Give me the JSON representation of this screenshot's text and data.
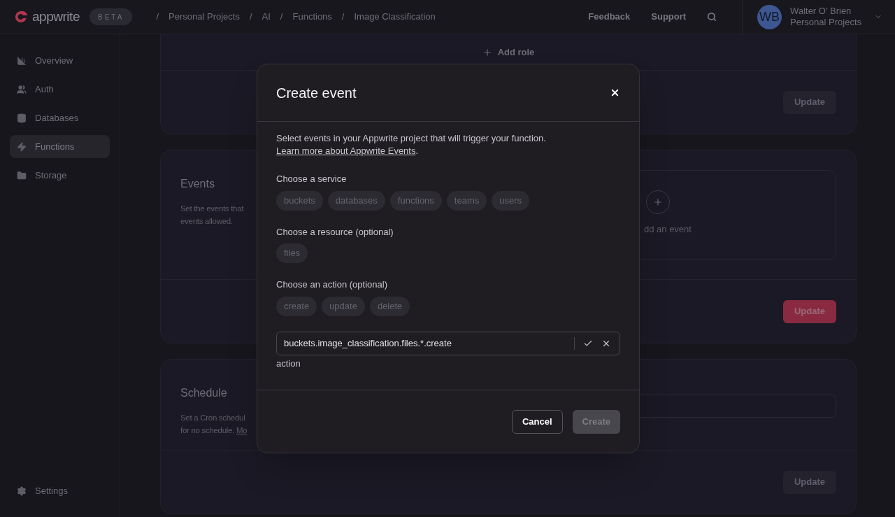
{
  "header": {
    "logo_text": "appwrite",
    "badge": "BETA",
    "breadcrumbs": [
      {
        "separator": "/",
        "label": "Personal Projects"
      },
      {
        "separator": "/",
        "label": "AI"
      },
      {
        "separator": "/",
        "label": "Functions"
      },
      {
        "separator": "/",
        "label": "Image Classification"
      }
    ],
    "links": [
      "Feedback",
      "Support"
    ],
    "user": {
      "initials": "WB",
      "name": "Walter O' Brien",
      "project": "Personal Projects"
    }
  },
  "sidebar": {
    "items": [
      {
        "kind": "overview",
        "label": "Overview",
        "selected": false
      },
      {
        "kind": "auth",
        "label": "Auth",
        "selected": false
      },
      {
        "kind": "databases",
        "label": "Databases",
        "selected": false
      },
      {
        "kind": "functions",
        "label": "Functions",
        "selected": true
      },
      {
        "kind": "storage",
        "label": "Storage",
        "selected": false
      }
    ],
    "footer_item": {
      "kind": "settings",
      "label": "Settings",
      "selected": false
    }
  },
  "cards": [
    {
      "kind": "roles",
      "add_label": "Add role",
      "button": {
        "label": "Update",
        "disabled": true
      }
    },
    {
      "kind": "events",
      "title": "Events",
      "description": [
        "Set the events that",
        "events allowed."
      ],
      "add_label": "dd an event",
      "button": {
        "label": "Update",
        "disabled": false
      }
    },
    {
      "kind": "schedule",
      "title": "Schedule",
      "description": [
        "Set a Cron schedul",
        "for no schedule."
      ],
      "link": "Mo",
      "button": {
        "label": "Update",
        "disabled": true
      }
    }
  ],
  "modal": {
    "title": "Create event",
    "intro": "Select events in your Appwrite project that will trigger your function.",
    "intro_link": "Learn more about Appwrite Events",
    "intro_end": ".",
    "groups": [
      {
        "label": "Choose a service",
        "options": [
          {
            "label": "buckets",
            "selected": false
          },
          {
            "label": "databases",
            "selected": false
          },
          {
            "label": "functions",
            "selected": false
          },
          {
            "label": "teams",
            "selected": false
          },
          {
            "label": "users",
            "selected": false
          }
        ]
      },
      {
        "label": "Choose a resource (optional)",
        "options": [
          {
            "label": "files",
            "selected": false
          }
        ]
      },
      {
        "label": "Choose an action (optional)",
        "options": [
          {
            "label": "create",
            "selected": false
          },
          {
            "label": "update",
            "selected": false
          },
          {
            "label": "delete",
            "selected": false
          }
        ]
      }
    ],
    "event_field": {
      "value": "buckets.image_classification.files.*.create"
    },
    "hint": "action",
    "cancel": "Cancel",
    "create": {
      "label": "Create",
      "disabled": true
    }
  }
}
